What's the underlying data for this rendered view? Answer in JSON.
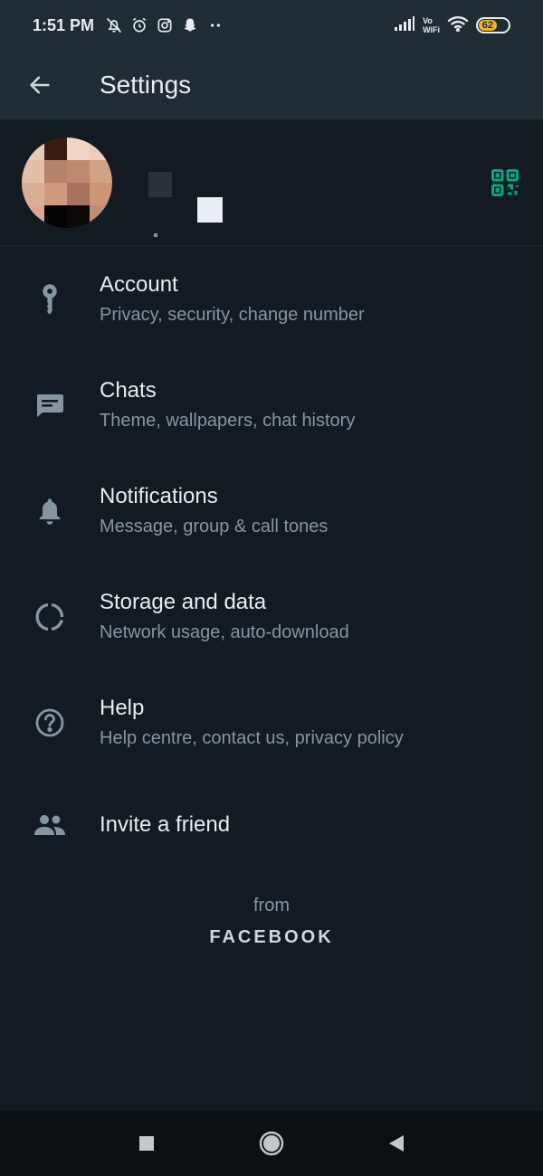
{
  "status_bar": {
    "time": "1:51 PM",
    "left_icons": [
      "bell-off-icon",
      "alarm-icon",
      "instagram-icon",
      "snapchat-icon",
      "more-dots-icon"
    ],
    "right_icons": [
      "signal-icon",
      "volte-wifi-icon",
      "wifi-icon"
    ],
    "volte_line1": "Vo",
    "volte_line2": "WiFi",
    "battery_level": "62"
  },
  "header": {
    "title": "Settings",
    "back_icon": "arrow-left-icon"
  },
  "profile": {
    "qr_icon": "qr-code-icon",
    "accent": "#00a884"
  },
  "menu": {
    "items": [
      {
        "label": "Account",
        "subtitle": "Privacy, security, change number",
        "icon": "key-icon"
      },
      {
        "label": "Chats",
        "subtitle": "Theme, wallpapers, chat history",
        "icon": "chat-icon"
      },
      {
        "label": "Notifications",
        "subtitle": "Message, group & call tones",
        "icon": "bell-icon"
      },
      {
        "label": "Storage and data",
        "subtitle": "Network usage, auto-download",
        "icon": "storage-icon"
      },
      {
        "label": "Help",
        "subtitle": "Help centre, contact us, privacy policy",
        "icon": "help-icon"
      },
      {
        "label": "Invite a friend",
        "icon": "people-icon"
      }
    ]
  },
  "footer": {
    "from": "from",
    "brand": "FACEBOOK"
  },
  "nav_bar": {
    "buttons": [
      "square-icon",
      "circle-icon",
      "triangle-back-icon"
    ]
  },
  "colors": {
    "background": "#121b22",
    "header": "#1f2c34",
    "primary_text": "#e9edef",
    "secondary_text": "#8696a0",
    "icon": "#8696a0",
    "accent": "#00a884"
  }
}
